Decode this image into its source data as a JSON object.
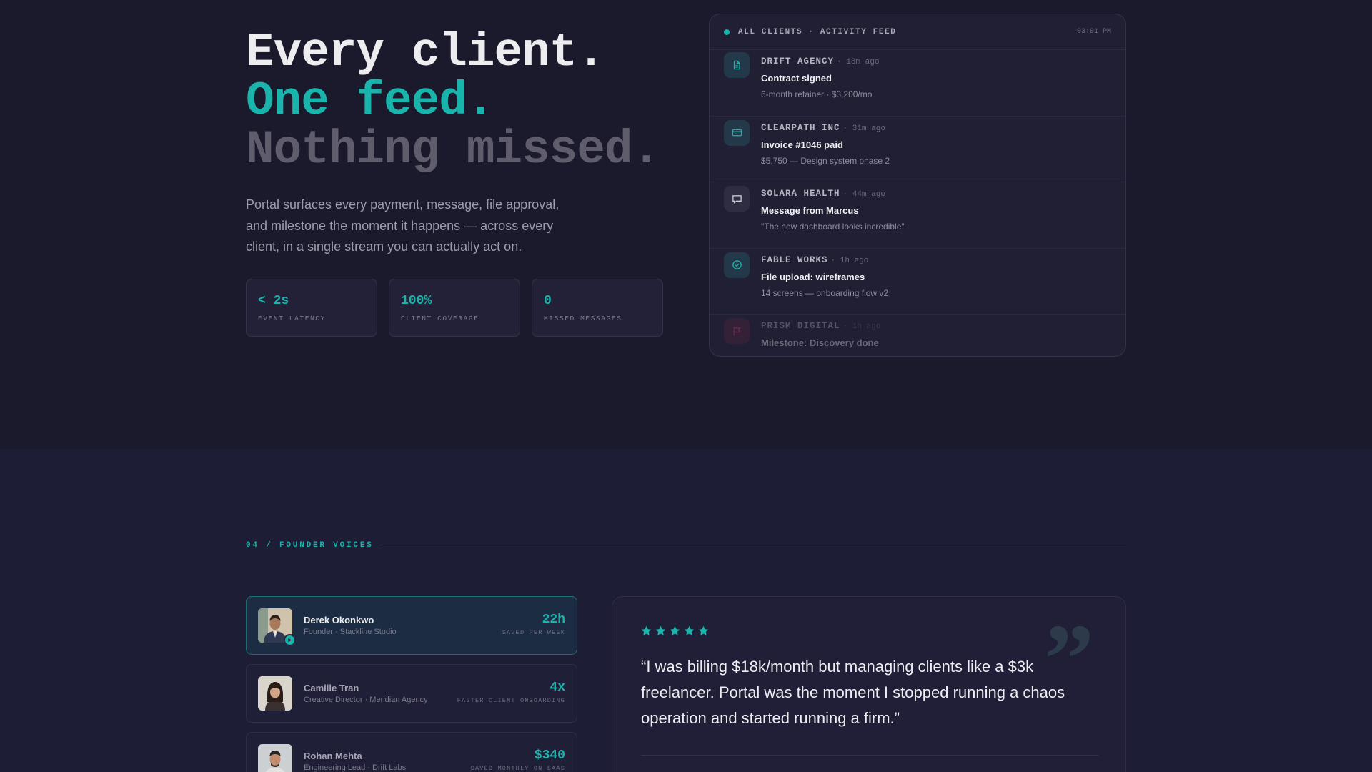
{
  "hero": {
    "headline": {
      "line1": "Every client.",
      "line2": "One feed.",
      "line3": "Nothing missed."
    },
    "description": "Portal surfaces every payment, message, file approval, and milestone the moment it happens — across every client, in a single stream you can actually act on.",
    "stats": [
      {
        "value": "< 2s",
        "label": "EVENT LATENCY"
      },
      {
        "value": "100%",
        "label": "CLIENT COVERAGE"
      },
      {
        "value": "0",
        "label": "MISSED MESSAGES"
      }
    ]
  },
  "feed": {
    "title": "ALL CLIENTS · ACTIVITY FEED",
    "time": "03:01 PM",
    "items": [
      {
        "client": "DRIFT AGENCY",
        "ago": "· 18m ago",
        "title": "Contract signed",
        "sub": "6-month retainer · $3,200/mo",
        "icon": "document-icon"
      },
      {
        "client": "CLEARPATH INC",
        "ago": "· 31m ago",
        "title": "Invoice #1046 paid",
        "sub": "$5,750 — Design system phase 2",
        "icon": "credit-card-icon"
      },
      {
        "client": "SOLARA HEALTH",
        "ago": "· 44m ago",
        "title": "Message from Marcus",
        "sub": "\"The new dashboard looks incredible\"",
        "icon": "chat-bubble-icon"
      },
      {
        "client": "FABLE WORKS",
        "ago": "· 1h ago",
        "title": "File upload: wireframes",
        "sub": "14 screens — onboarding flow v2",
        "icon": "check-circle-icon"
      },
      {
        "client": "PRISM DIGITAL",
        "ago": "· 1h ago",
        "title": "Milestone: Discovery done",
        "sub": "",
        "icon": "flag-icon"
      }
    ]
  },
  "section": {
    "label": "04 / FOUNDER VOICES"
  },
  "voices": [
    {
      "name": "Derek Okonkwo",
      "role": "Founder · Stackline Studio",
      "metric": "22h",
      "metric_label": "SAVED PER WEEK"
    },
    {
      "name": "Camille Tran",
      "role": "Creative Director · Meridian Agency",
      "metric": "4x",
      "metric_label": "FASTER CLIENT ONBOARDING"
    },
    {
      "name": "Rohan Mehta",
      "role": "Engineering Lead · Drift Labs",
      "metric": "$340",
      "metric_label": "SAVED MONTHLY ON SAAS"
    }
  ],
  "testimonial": {
    "rating": 5,
    "quote": "“I was billing $18k/month but managing clients like a $3k freelancer. Portal was the moment I stopped running a chaos operation and started running a firm.”"
  },
  "colors": {
    "accent": "#19b5ac",
    "background": "#1b1a2c",
    "section_background": "#1e1d36"
  }
}
